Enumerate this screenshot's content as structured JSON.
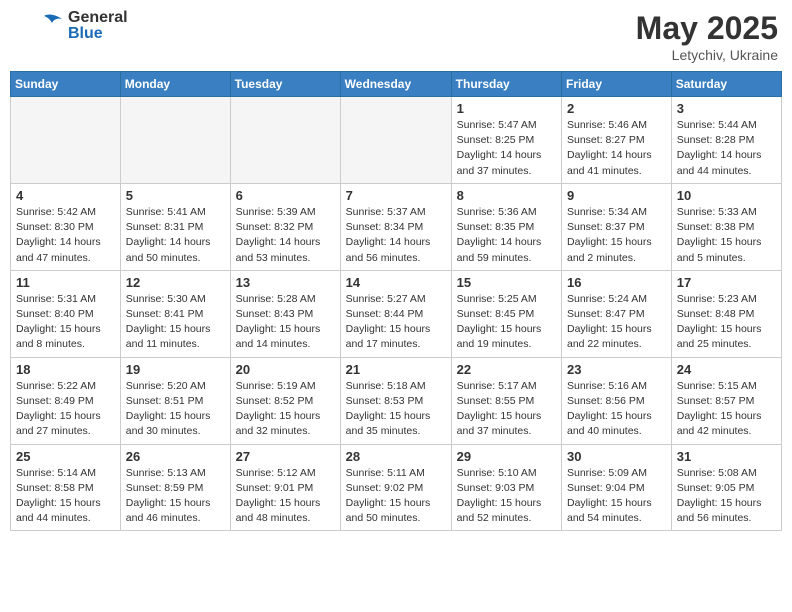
{
  "header": {
    "logo_general": "General",
    "logo_blue": "Blue",
    "month": "May 2025",
    "location": "Letychiv, Ukraine"
  },
  "weekdays": [
    "Sunday",
    "Monday",
    "Tuesday",
    "Wednesday",
    "Thursday",
    "Friday",
    "Saturday"
  ],
  "weeks": [
    [
      {
        "day": "",
        "info": ""
      },
      {
        "day": "",
        "info": ""
      },
      {
        "day": "",
        "info": ""
      },
      {
        "day": "",
        "info": ""
      },
      {
        "day": "1",
        "info": "Sunrise: 5:47 AM\nSunset: 8:25 PM\nDaylight: 14 hours\nand 37 minutes."
      },
      {
        "day": "2",
        "info": "Sunrise: 5:46 AM\nSunset: 8:27 PM\nDaylight: 14 hours\nand 41 minutes."
      },
      {
        "day": "3",
        "info": "Sunrise: 5:44 AM\nSunset: 8:28 PM\nDaylight: 14 hours\nand 44 minutes."
      }
    ],
    [
      {
        "day": "4",
        "info": "Sunrise: 5:42 AM\nSunset: 8:30 PM\nDaylight: 14 hours\nand 47 minutes."
      },
      {
        "day": "5",
        "info": "Sunrise: 5:41 AM\nSunset: 8:31 PM\nDaylight: 14 hours\nand 50 minutes."
      },
      {
        "day": "6",
        "info": "Sunrise: 5:39 AM\nSunset: 8:32 PM\nDaylight: 14 hours\nand 53 minutes."
      },
      {
        "day": "7",
        "info": "Sunrise: 5:37 AM\nSunset: 8:34 PM\nDaylight: 14 hours\nand 56 minutes."
      },
      {
        "day": "8",
        "info": "Sunrise: 5:36 AM\nSunset: 8:35 PM\nDaylight: 14 hours\nand 59 minutes."
      },
      {
        "day": "9",
        "info": "Sunrise: 5:34 AM\nSunset: 8:37 PM\nDaylight: 15 hours\nand 2 minutes."
      },
      {
        "day": "10",
        "info": "Sunrise: 5:33 AM\nSunset: 8:38 PM\nDaylight: 15 hours\nand 5 minutes."
      }
    ],
    [
      {
        "day": "11",
        "info": "Sunrise: 5:31 AM\nSunset: 8:40 PM\nDaylight: 15 hours\nand 8 minutes."
      },
      {
        "day": "12",
        "info": "Sunrise: 5:30 AM\nSunset: 8:41 PM\nDaylight: 15 hours\nand 11 minutes."
      },
      {
        "day": "13",
        "info": "Sunrise: 5:28 AM\nSunset: 8:43 PM\nDaylight: 15 hours\nand 14 minutes."
      },
      {
        "day": "14",
        "info": "Sunrise: 5:27 AM\nSunset: 8:44 PM\nDaylight: 15 hours\nand 17 minutes."
      },
      {
        "day": "15",
        "info": "Sunrise: 5:25 AM\nSunset: 8:45 PM\nDaylight: 15 hours\nand 19 minutes."
      },
      {
        "day": "16",
        "info": "Sunrise: 5:24 AM\nSunset: 8:47 PM\nDaylight: 15 hours\nand 22 minutes."
      },
      {
        "day": "17",
        "info": "Sunrise: 5:23 AM\nSunset: 8:48 PM\nDaylight: 15 hours\nand 25 minutes."
      }
    ],
    [
      {
        "day": "18",
        "info": "Sunrise: 5:22 AM\nSunset: 8:49 PM\nDaylight: 15 hours\nand 27 minutes."
      },
      {
        "day": "19",
        "info": "Sunrise: 5:20 AM\nSunset: 8:51 PM\nDaylight: 15 hours\nand 30 minutes."
      },
      {
        "day": "20",
        "info": "Sunrise: 5:19 AM\nSunset: 8:52 PM\nDaylight: 15 hours\nand 32 minutes."
      },
      {
        "day": "21",
        "info": "Sunrise: 5:18 AM\nSunset: 8:53 PM\nDaylight: 15 hours\nand 35 minutes."
      },
      {
        "day": "22",
        "info": "Sunrise: 5:17 AM\nSunset: 8:55 PM\nDaylight: 15 hours\nand 37 minutes."
      },
      {
        "day": "23",
        "info": "Sunrise: 5:16 AM\nSunset: 8:56 PM\nDaylight: 15 hours\nand 40 minutes."
      },
      {
        "day": "24",
        "info": "Sunrise: 5:15 AM\nSunset: 8:57 PM\nDaylight: 15 hours\nand 42 minutes."
      }
    ],
    [
      {
        "day": "25",
        "info": "Sunrise: 5:14 AM\nSunset: 8:58 PM\nDaylight: 15 hours\nand 44 minutes."
      },
      {
        "day": "26",
        "info": "Sunrise: 5:13 AM\nSunset: 8:59 PM\nDaylight: 15 hours\nand 46 minutes."
      },
      {
        "day": "27",
        "info": "Sunrise: 5:12 AM\nSunset: 9:01 PM\nDaylight: 15 hours\nand 48 minutes."
      },
      {
        "day": "28",
        "info": "Sunrise: 5:11 AM\nSunset: 9:02 PM\nDaylight: 15 hours\nand 50 minutes."
      },
      {
        "day": "29",
        "info": "Sunrise: 5:10 AM\nSunset: 9:03 PM\nDaylight: 15 hours\nand 52 minutes."
      },
      {
        "day": "30",
        "info": "Sunrise: 5:09 AM\nSunset: 9:04 PM\nDaylight: 15 hours\nand 54 minutes."
      },
      {
        "day": "31",
        "info": "Sunrise: 5:08 AM\nSunset: 9:05 PM\nDaylight: 15 hours\nand 56 minutes."
      }
    ]
  ]
}
